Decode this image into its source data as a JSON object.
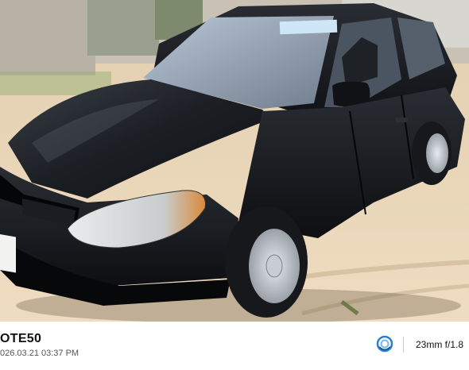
{
  "photo": {
    "subject": "black-sedan",
    "windshield_sticker_color": "#cfe6f7"
  },
  "watermark": {
    "brand": "OTE50",
    "datetime": "026.03.21  03:37 PM",
    "lens": "23mm  f/1.8",
    "logo_icon": "camera-brand-logo-icon",
    "accent_color": "#2a7fd4"
  }
}
